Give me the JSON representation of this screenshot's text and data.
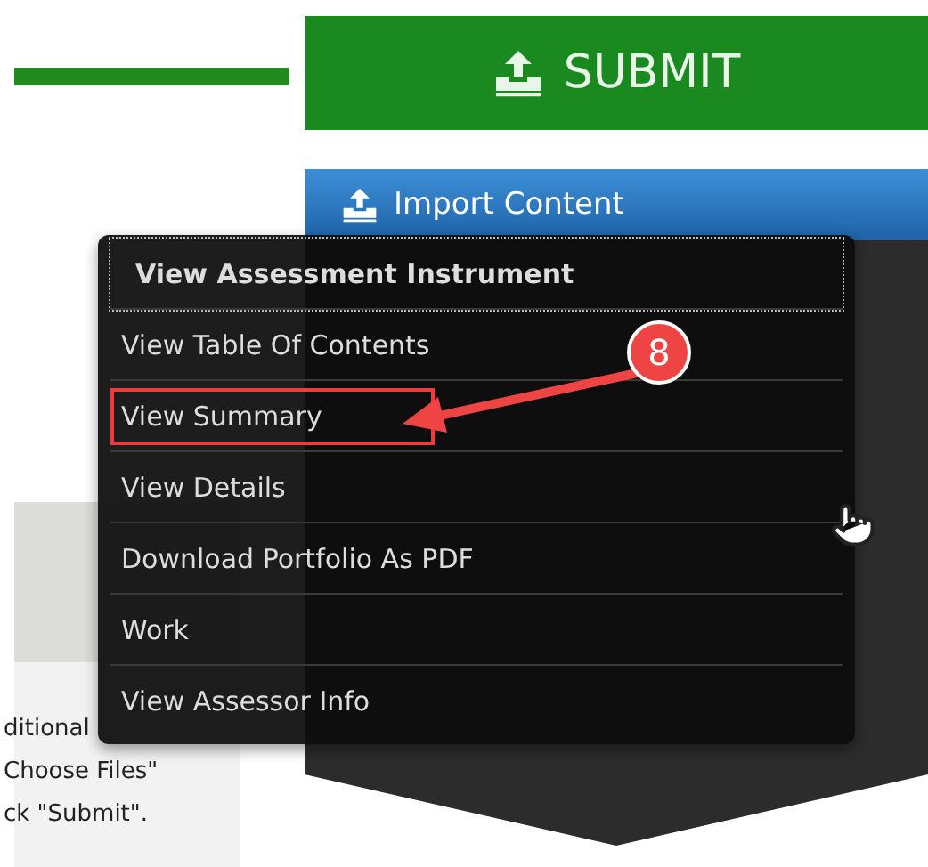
{
  "submit_button": {
    "label": "SUBMIT"
  },
  "import_bar": {
    "label": "Import Content"
  },
  "menu": {
    "items": [
      {
        "label": "View Assessment Instrument",
        "focused": true,
        "highlighted": false
      },
      {
        "label": "View Table Of Contents",
        "focused": false,
        "highlighted": false
      },
      {
        "label": "View Summary",
        "focused": false,
        "highlighted": true
      },
      {
        "label": "View Details",
        "focused": false,
        "highlighted": false
      },
      {
        "label": "Download Portfolio As PDF",
        "focused": false,
        "highlighted": false
      },
      {
        "label": "Work",
        "focused": false,
        "highlighted": false
      },
      {
        "label": "View Assessor Info",
        "focused": false,
        "highlighted": false
      }
    ]
  },
  "annotation": {
    "number": "8"
  },
  "instructions": {
    "lines": [
      "ditional",
      "Choose Files\"",
      "ck \"Submit\"."
    ]
  }
}
